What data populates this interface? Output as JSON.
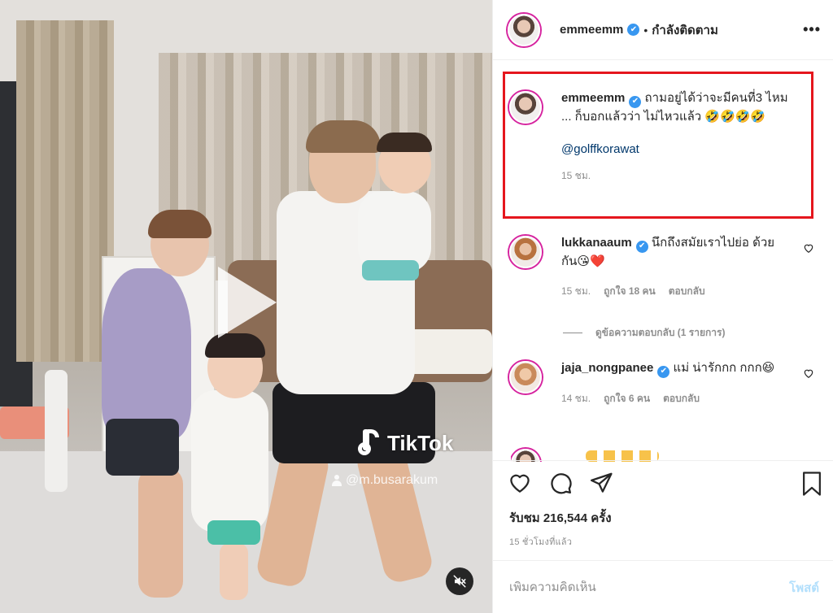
{
  "media": {
    "watermark_brand": "TikTok",
    "watermark_user": "@m.busarakum"
  },
  "header": {
    "username": "emmeemm",
    "verified_mark": "✔",
    "separator": "•",
    "follow_status": "กำลังติดตาม",
    "more_label": "•••"
  },
  "caption": {
    "username": "emmeemm",
    "text": " ถามอยู่ได้ว่าจะมีคนที่3 ไหม ... ก็บอกแล้วว่า ไม่ไหวแล้ว 🤣🤣🤣🤣",
    "mention": "@golffkorawat",
    "time": "15 ชม."
  },
  "comments": [
    {
      "username": "lukkanaaum",
      "text": " นึกถึงสมัยเราไปย่อ ด้วยกัน😘❤️",
      "time": "15 ชม.",
      "likes": "ถูกใจ 18 คน",
      "reply": "ตอบกลับ"
    },
    {
      "username": "jaja_nongpanee",
      "text": " แม่ น่ารักกก กกก😆",
      "time": "14 ชม.",
      "likes": "ถูกใจ 6 คน",
      "reply": "ตอบกลับ"
    }
  ],
  "view_replies": "ดูข้อความตอบกลับ (1 รายการ)",
  "stats": {
    "views": "รับชม 216,544 ครั้ง",
    "time_ago": "15 ชั่วโมงที่แล้ว"
  },
  "add_comment": {
    "placeholder": "เพิ่มความคิดเห็น",
    "post_label": "โพสต์"
  },
  "colors": {
    "highlight_box": "#e5161d",
    "verified": "#3897f0",
    "heart": "#ed4956",
    "post_disabled": "#b2dffc"
  }
}
